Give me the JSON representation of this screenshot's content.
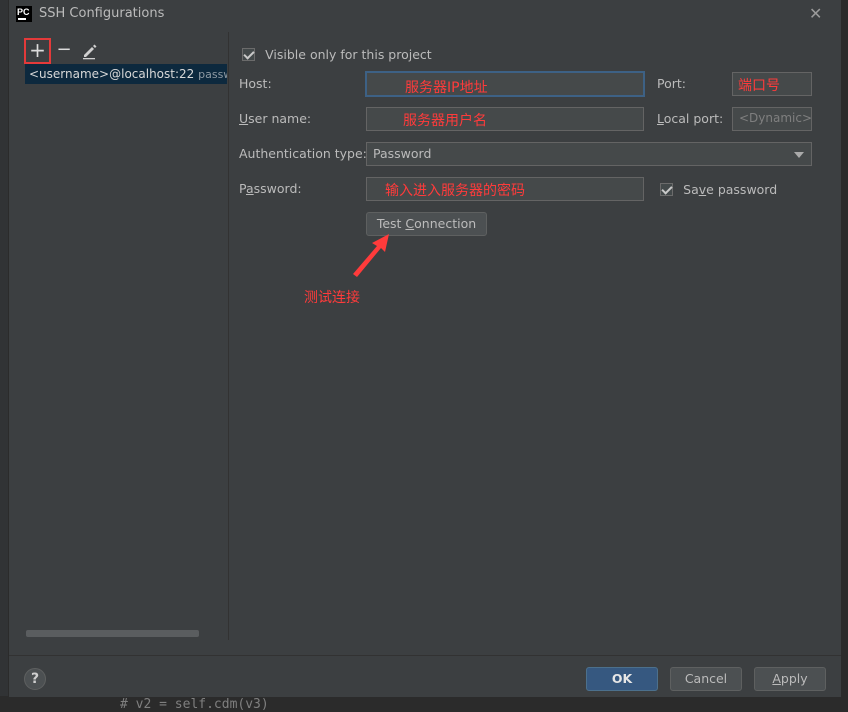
{
  "window": {
    "title": "SSH Configurations",
    "app_icon_text": "PC",
    "close_glyph": "✕"
  },
  "toolbar": {
    "add_glyph": "+",
    "remove_glyph": "−",
    "edit_icon": "pencil-icon"
  },
  "list": {
    "items": [
      {
        "name": "<username>@localhost:22",
        "auth": "password"
      }
    ]
  },
  "form": {
    "visible_only_label": "Visible only for this project",
    "visible_only_checked": true,
    "host_label": "Host:",
    "host_value": "",
    "port_label": "Port:",
    "port_value": "",
    "username_label": "User name:",
    "username_value": "",
    "local_port_label": "Local port:",
    "local_port_placeholder": "<Dynamic>",
    "auth_type_label": "Authentication type:",
    "auth_type_value": "Password",
    "password_label": "Password:",
    "password_value": "",
    "save_password_label": "Save password",
    "save_password_checked": true,
    "test_connection_label": "Test Connection"
  },
  "annotations": {
    "host": "服务器IP地址",
    "port": "端口号",
    "username": "服务器用户名",
    "password": "输入进入服务器的密码",
    "test": "测试连接",
    "color": "#ff3b3b"
  },
  "footer": {
    "help_glyph": "?",
    "ok_label": "OK",
    "cancel_label": "Cancel",
    "apply_label": "Apply"
  },
  "background": {
    "code_line": "# v2 = self.cdm(v3)"
  },
  "colors": {
    "dialog_bg": "#3c3f41",
    "field_bg": "#45494a",
    "selection": "#0d293e",
    "primary_button": "#365880",
    "focus_border": "#3d6185",
    "highlight_box": "#e43a3a"
  }
}
